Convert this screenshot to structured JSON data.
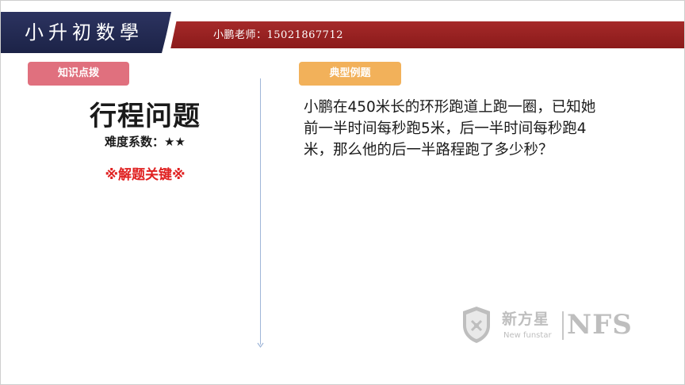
{
  "header": {
    "brand": "小升初数學",
    "teacher": "小鹏老师：15021867712",
    "colors": {
      "navy": "#1c2347",
      "red": "#8b1a1a"
    }
  },
  "left": {
    "tag": "知识点拨",
    "tag_color": "#e0707e",
    "topic": "行程问题",
    "difficulty": "难度系数：★★",
    "key": "※解题关键※",
    "key_color": "#e02020"
  },
  "right": {
    "tag": "典型例题",
    "tag_color": "#f2b15a",
    "problem_lines": [
      "小鹏在450米长的环形跑道上跑一圈，已知她",
      "前一半时间每秒跑5米，后一半时间每秒跑4",
      "米，那么他的后一半路程跑了多少秒？"
    ]
  },
  "watermark": {
    "cn": "新方星",
    "en": "New funstar",
    "abbr": "NFS",
    "icon": "shield-badge-icon"
  }
}
